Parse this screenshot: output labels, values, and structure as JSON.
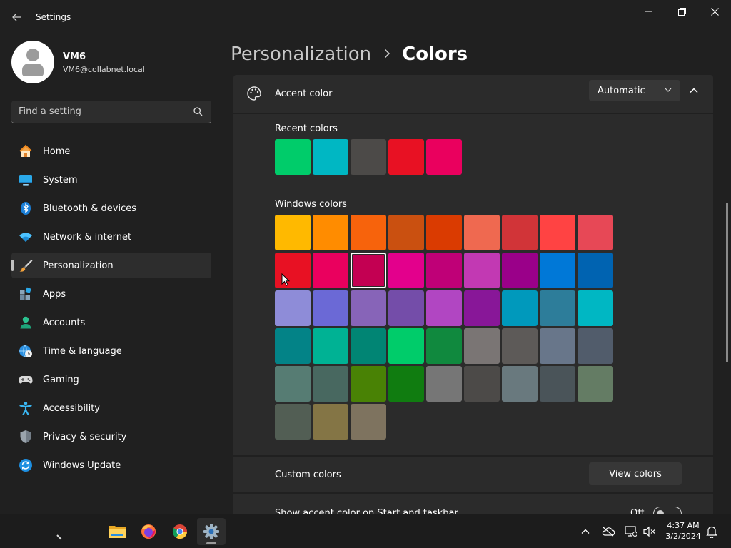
{
  "window": {
    "title": "Settings"
  },
  "user": {
    "name": "VM6",
    "email": "VM6@collabnet.local"
  },
  "search": {
    "placeholder": "Find a setting"
  },
  "nav": [
    {
      "label": "Home",
      "icon": "home-icon"
    },
    {
      "label": "System",
      "icon": "system-icon"
    },
    {
      "label": "Bluetooth & devices",
      "icon": "bluetooth-icon"
    },
    {
      "label": "Network & internet",
      "icon": "wifi-icon"
    },
    {
      "label": "Personalization",
      "icon": "brush-icon",
      "selected": true
    },
    {
      "label": "Apps",
      "icon": "apps-icon"
    },
    {
      "label": "Accounts",
      "icon": "accounts-icon"
    },
    {
      "label": "Time & language",
      "icon": "clock-globe-icon"
    },
    {
      "label": "Gaming",
      "icon": "gamepad-icon"
    },
    {
      "label": "Accessibility",
      "icon": "accessibility-icon"
    },
    {
      "label": "Privacy & security",
      "icon": "shield-icon"
    },
    {
      "label": "Windows Update",
      "icon": "update-icon"
    }
  ],
  "breadcrumb": {
    "parent": "Personalization",
    "current": "Colors"
  },
  "accent": {
    "label": "Accent color",
    "mode": "Automatic",
    "recent_title": "Recent colors",
    "recent": [
      "#00cc6a",
      "#00b7c3",
      "#4c4a48",
      "#e81123",
      "#ea005e"
    ],
    "windows_title": "Windows colors",
    "windows": [
      "#ffb900",
      "#ff8c00",
      "#f7630c",
      "#ca5010",
      "#da3b01",
      "#ef6950",
      "#d13438",
      "#ff4343",
      "#e74856",
      "#e81123",
      "#ea005e",
      "#c30052",
      "#e3008c",
      "#bf0077",
      "#c239b3",
      "#9a0089",
      "#0078d7",
      "#0063b1",
      "#8e8cd8",
      "#6b69d6",
      "#8764b8",
      "#744da9",
      "#b146c2",
      "#881798",
      "#0099bc",
      "#2d7d9a",
      "#00b7c3",
      "#038387",
      "#00b294",
      "#018574",
      "#00cc6a",
      "#10893e",
      "#7a7574",
      "#5d5a58",
      "#68768a",
      "#515c6b",
      "#567c73",
      "#486860",
      "#498205",
      "#107c10",
      "#767676",
      "#4c4a48",
      "#69797e",
      "#4a5459",
      "#647c64",
      "#525e54",
      "#847545",
      "#7e735f"
    ],
    "selected_index": 11
  },
  "custom": {
    "label": "Custom colors",
    "button": "View colors"
  },
  "start_taskbar": {
    "label": "Show accent color on Start and taskbar",
    "state": "Off"
  },
  "taskbar": {
    "apps": [
      "file-explorer-icon",
      "firefox-icon",
      "chrome-icon",
      "settings-icon"
    ],
    "time": "4:37 AM",
    "date": "3/2/2024"
  }
}
